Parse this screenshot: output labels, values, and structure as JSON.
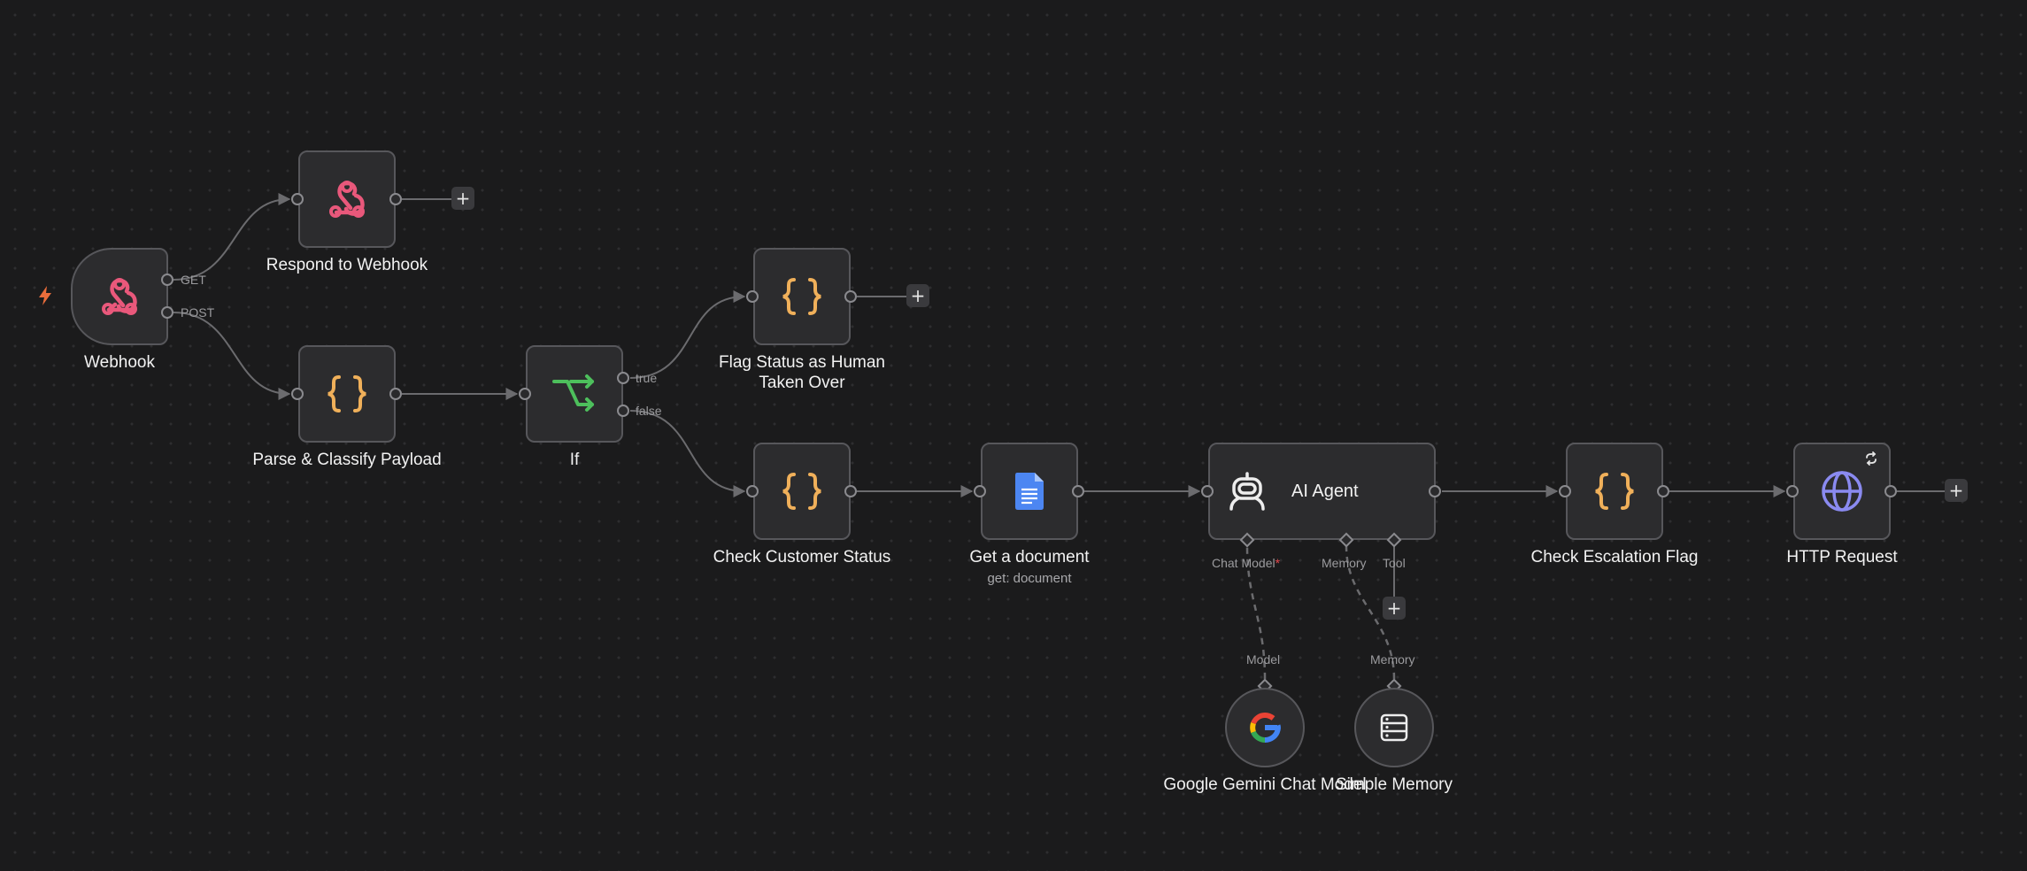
{
  "workflow": {
    "nodes": {
      "webhook": {
        "label": "Webhook",
        "outputs": [
          "GET",
          "POST"
        ],
        "icon": "webhook-icon"
      },
      "respond": {
        "label": "Respond to Webhook",
        "icon": "webhook-icon"
      },
      "parse": {
        "label": "Parse & Classify Payload",
        "icon": "code-braces-icon"
      },
      "if_node": {
        "label": "If",
        "outputs": [
          "true",
          "false"
        ],
        "icon": "branch-icon"
      },
      "flag": {
        "label": "Flag Status as Human Taken Over",
        "icon": "code-braces-icon"
      },
      "check_customer": {
        "label": "Check Customer Status",
        "icon": "code-braces-icon"
      },
      "get_doc": {
        "label": "Get a document",
        "subtitle": "get: document",
        "icon": "google-docs-icon"
      },
      "agent": {
        "label": "AI Agent",
        "icon": "robot-icon",
        "inputs": {
          "chat_model": "Chat Model",
          "required_mark": "*",
          "memory": "Memory",
          "tool": "Tool"
        }
      },
      "check_escalation": {
        "label": "Check Escalation Flag",
        "icon": "code-braces-icon"
      },
      "http": {
        "label": "HTTP Request",
        "icon": "globe-icon"
      },
      "gemini": {
        "label": "Google Gemini Chat Model",
        "port": "Model",
        "icon": "google-icon"
      },
      "memory": {
        "label": "Simple Memory",
        "port": "Memory",
        "icon": "database-icon"
      }
    },
    "add_button": "+"
  },
  "colors": {
    "background": "#1b1b1c",
    "node_fill": "#2c2c2e",
    "node_border": "#57575b",
    "edge": "#6b6b6e",
    "webhook": "#e9587b",
    "code": "#f0b05a",
    "branch": "#4dbf5c",
    "docs": "#4c86f2",
    "globe": "#8a8af0",
    "trigger": "#ea6d3b"
  }
}
